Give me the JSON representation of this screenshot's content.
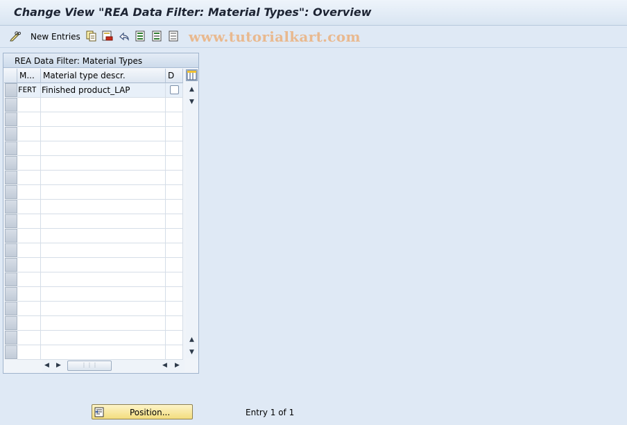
{
  "window": {
    "title": "Change View \"REA Data Filter: Material Types\": Overview"
  },
  "toolbar": {
    "new_entries_label": "New Entries",
    "watermark": "www.tutorialkart.com",
    "icons": [
      "pencil-glasses-icon",
      "copy-icon",
      "delete-icon",
      "undo-icon",
      "select-all-icon",
      "select-block-icon",
      "deselect-all-icon"
    ]
  },
  "panel": {
    "title": "REA Data Filter: Material Types",
    "columns": [
      "M...",
      "Material type descr.",
      "D"
    ],
    "rows": [
      {
        "code": "FERT",
        "description": "Finished product_LAP",
        "checked": false
      }
    ],
    "empty_row_count": 18
  },
  "footer": {
    "position_label": "Position...",
    "entry_status": "Entry 1 of 1"
  },
  "colors": {
    "background": "#dfe9f5",
    "button_yellow": "#f3dd7e",
    "watermark": "#e9b98f"
  }
}
